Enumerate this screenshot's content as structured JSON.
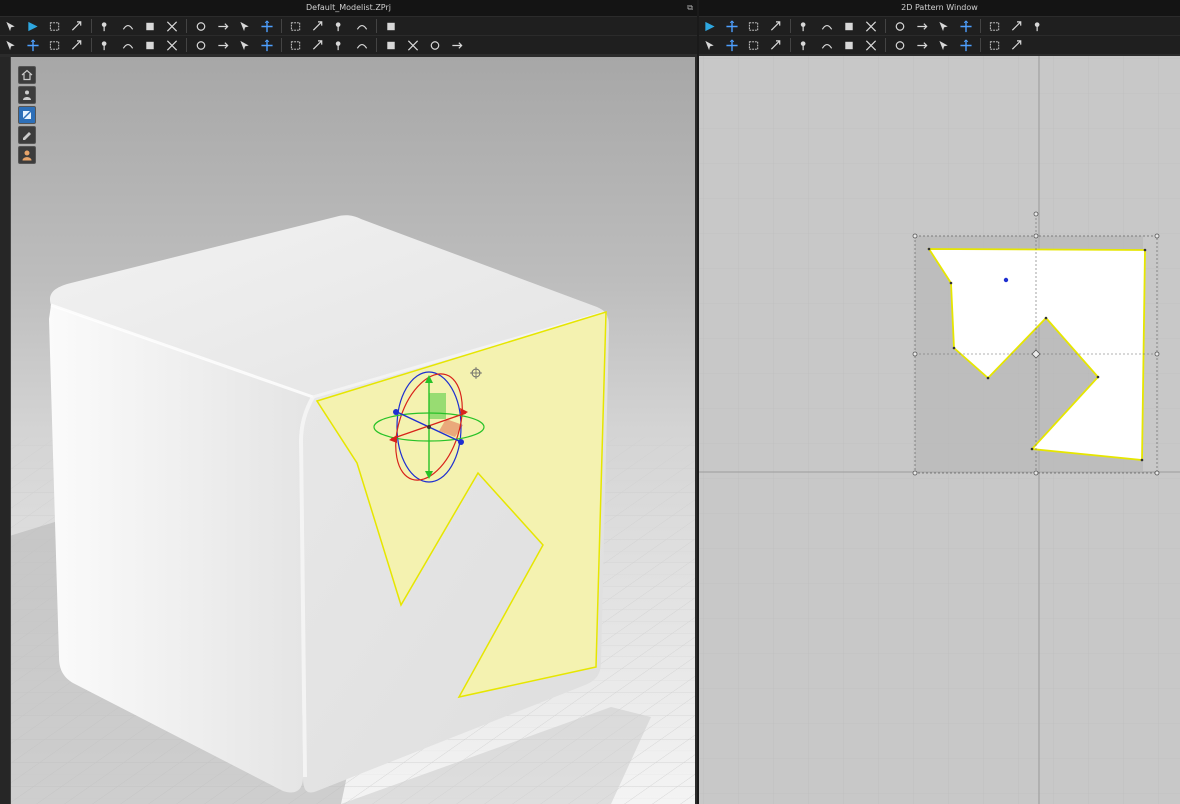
{
  "windows": {
    "viewport3d": {
      "title": "Default_Modelist.ZPrj",
      "corner_icon": "maximize-icon"
    },
    "pattern2d": {
      "title": "2D Pattern Window"
    }
  },
  "toolbar3d": {
    "row1": [
      "select-move-icon",
      "transform-icon",
      "box-select-icon",
      "resize-icon",
      "pin-icon",
      "fold-icon",
      "tack-icon",
      "arrange-icon",
      "avatar-icon",
      "measure-icon",
      "hanger-icon",
      "button-icon",
      "topstitch-icon",
      "pleat-icon",
      "shrink-icon",
      "puckering-icon",
      "line-icon"
    ],
    "row2": [
      "simulation-icon",
      "fold-arrangement-icon",
      "steam-icon",
      "smooth-icon",
      "layer-icon",
      "zipper-icon",
      "puff-icon",
      "texture-icon",
      "graphic-icon",
      "trim-icon",
      "seam-icon",
      "tape-icon",
      "puckering-seam-icon",
      "elastic-icon",
      "weld-icon",
      "measure-line-icon",
      "dimension-icon",
      "pattern-icon",
      "bone-icon",
      "reset-icon"
    ]
  },
  "toolbar2d": {
    "row1": [
      "edit-pattern-icon",
      "edit-point-icon",
      "add-point-icon",
      "curve-icon",
      "curvature-icon",
      "cut-icon",
      "rectangle-icon",
      "polygon-icon",
      "circle-icon",
      "internal-rect-icon",
      "internal-circle-icon",
      "dart-icon",
      "fold-icon",
      "notch-icon",
      "hem-icon"
    ],
    "row2": [
      "segment-sewing-icon",
      "free-sewing-icon",
      "m-n-sewing-icon",
      "edit-sewing-icon",
      "tack-icon",
      "fabric-grain-icon",
      "pin-icon",
      "button-icon",
      "zipper-icon",
      "measure-icon",
      "grading-icon",
      "trace-icon",
      "elastic-icon",
      "baseline-icon"
    ]
  },
  "viewport_tools": [
    "home-icon",
    "avatar-view-icon",
    "texture-view-icon",
    "edit-view-icon",
    "avatar-render-icon"
  ],
  "colors": {
    "selection_outline": "#e6e600",
    "pattern_highlight": "#f4f2b0",
    "gizmo_red": "#d8231b",
    "gizmo_green": "#27c227",
    "gizmo_blue": "#1e2fd0",
    "viewport_bg_top": "#a9a9a9",
    "pattern_window_bg": "#c8c8c8"
  }
}
